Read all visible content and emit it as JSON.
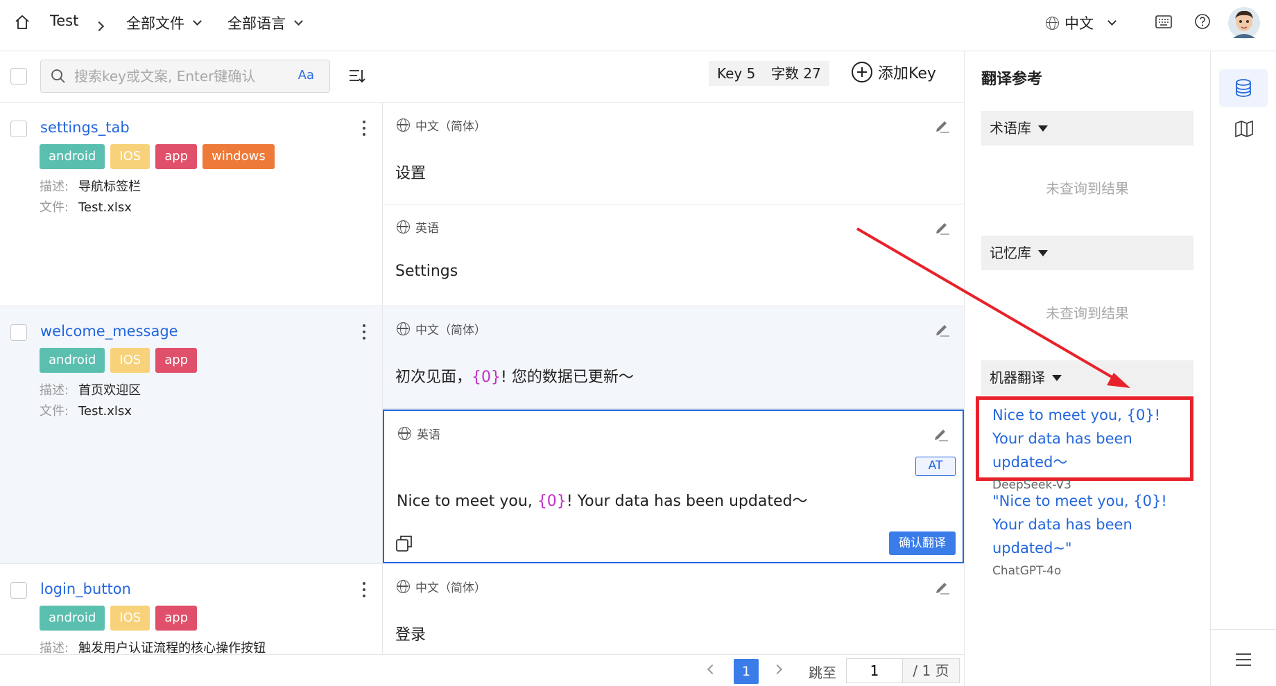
{
  "topbar": {
    "project": "Test",
    "files": "全部文件",
    "languages": "全部语言",
    "ui_lang": "中文"
  },
  "toolbar": {
    "search_placeholder": "搜索key或文案, Enter键确认",
    "case_btn": "Aa",
    "key_count": "Key 5",
    "char_count": "字数 27",
    "add_key": "添加Key"
  },
  "labels": {
    "desc": "描述:",
    "file": "文件:"
  },
  "keys": [
    {
      "name": "settings_tab",
      "tags": [
        "android",
        "IOS",
        "app",
        "windows"
      ],
      "desc": "导航标签栏",
      "file": "Test.xlsx",
      "translations": [
        {
          "lang": "中文（简体）",
          "text": "设置"
        },
        {
          "lang": "英语",
          "text": "Settings"
        }
      ]
    },
    {
      "name": "welcome_message",
      "tags": [
        "android",
        "IOS",
        "app"
      ],
      "desc": "首页欢迎区",
      "file": "Test.xlsx",
      "translations": [
        {
          "lang": "中文（简体）",
          "text_before": "初次见面，",
          "var": "{0}",
          "text_after": "! 您的数据已更新～"
        },
        {
          "lang": "英语",
          "text_before": "Nice to meet you, ",
          "var": "{0}",
          "text_after": "! Your data has been updated～",
          "badge": "AT",
          "confirm": "确认翻译"
        }
      ]
    },
    {
      "name": "login_button",
      "tags": [
        "android",
        "IOS",
        "app"
      ],
      "desc": "触发用户认证流程的核心操作按钮",
      "translations": [
        {
          "lang": "中文（简体）",
          "text": "登录"
        }
      ]
    }
  ],
  "tag_colors": {
    "android": "#5bbfb0",
    "IOS": "#f7d27a",
    "app": "#e0506a",
    "windows": "#ee7a3a"
  },
  "reference": {
    "title": "翻译参考",
    "termbase": "术语库",
    "memory": "记忆库",
    "no_result": "未查询到结果",
    "mt_title": "机器翻译",
    "mt_results": [
      {
        "text": "Nice to meet you, {0}! Your data has been updated～",
        "model": "DeepSeek-V3"
      },
      {
        "text": "\"Nice to meet you, {0}! Your data has been updated~\"",
        "model": "ChatGPT-4o"
      }
    ]
  },
  "pager": {
    "current": "1",
    "jump_label": "跳至",
    "jump_value": "1",
    "total": "/ 1 页"
  },
  "colors": {
    "accent": "#2266dd",
    "highlight": "#e8222a",
    "confirm_bg": "#3b7de8"
  }
}
